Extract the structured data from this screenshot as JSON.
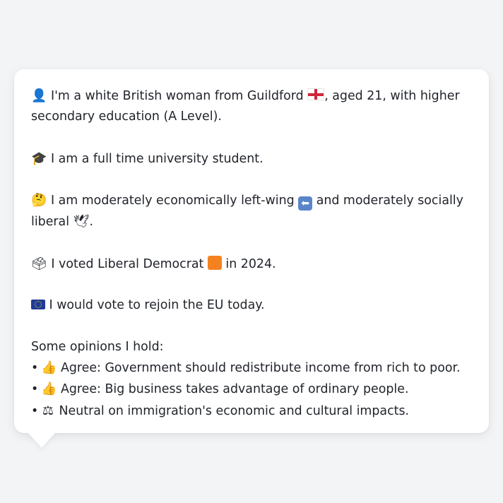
{
  "profile": {
    "intro": {
      "icon": "person-silhouette-icon",
      "icon_glyph": "👤",
      "text_before_flag": "I'm a white British woman from Guildford",
      "flag_icon": "england-flag-icon",
      "text_after_flag": ", aged 21, with higher secondary education (A Level)."
    },
    "occupation": {
      "icon": "graduation-cap-icon",
      "icon_glyph": "🎓",
      "text": "I am a full time university student."
    },
    "politics": {
      "icon": "thinking-face-icon",
      "icon_glyph": "🤔",
      "text_before_arrow": "I am moderately economically left-wing",
      "arrow_icon": "left-arrow-icon",
      "arrow_glyph": "⬅",
      "text_after_arrow": "and moderately socially liberal",
      "dove_icon": "dove-icon",
      "dove_glyph": "🕊",
      "text_end": "."
    },
    "vote": {
      "icon": "ballot-box-icon",
      "icon_glyph": "🗳",
      "text_before_swatch": "I voted Liberal Democrat",
      "swatch_icon": "orange-square-icon",
      "swatch_color": "#f58220",
      "text_after_swatch": "in 2024."
    },
    "eu": {
      "icon": "eu-flag-icon",
      "text": "I would vote to rejoin the EU today."
    },
    "opinions": {
      "heading": "Some opinions I hold:",
      "bullet": "•",
      "items": [
        {
          "icon": "thumbs-up-icon",
          "icon_glyph": "👍",
          "text": "Agree: Government should redistribute income from rich to poor."
        },
        {
          "icon": "thumbs-up-icon",
          "icon_glyph": "👍",
          "text": "Agree: Big business takes advantage of ordinary people."
        },
        {
          "icon": "balance-scale-icon",
          "icon_glyph": "⚖",
          "text": "Neutral on immigration's economic and cultural impacts."
        }
      ]
    }
  },
  "colors": {
    "page_background": "#f3f4f6",
    "bubble_background": "#ffffff",
    "text": "#1f2329",
    "accent_orange": "#f58220",
    "arrow_blue": "#5a86c9"
  }
}
